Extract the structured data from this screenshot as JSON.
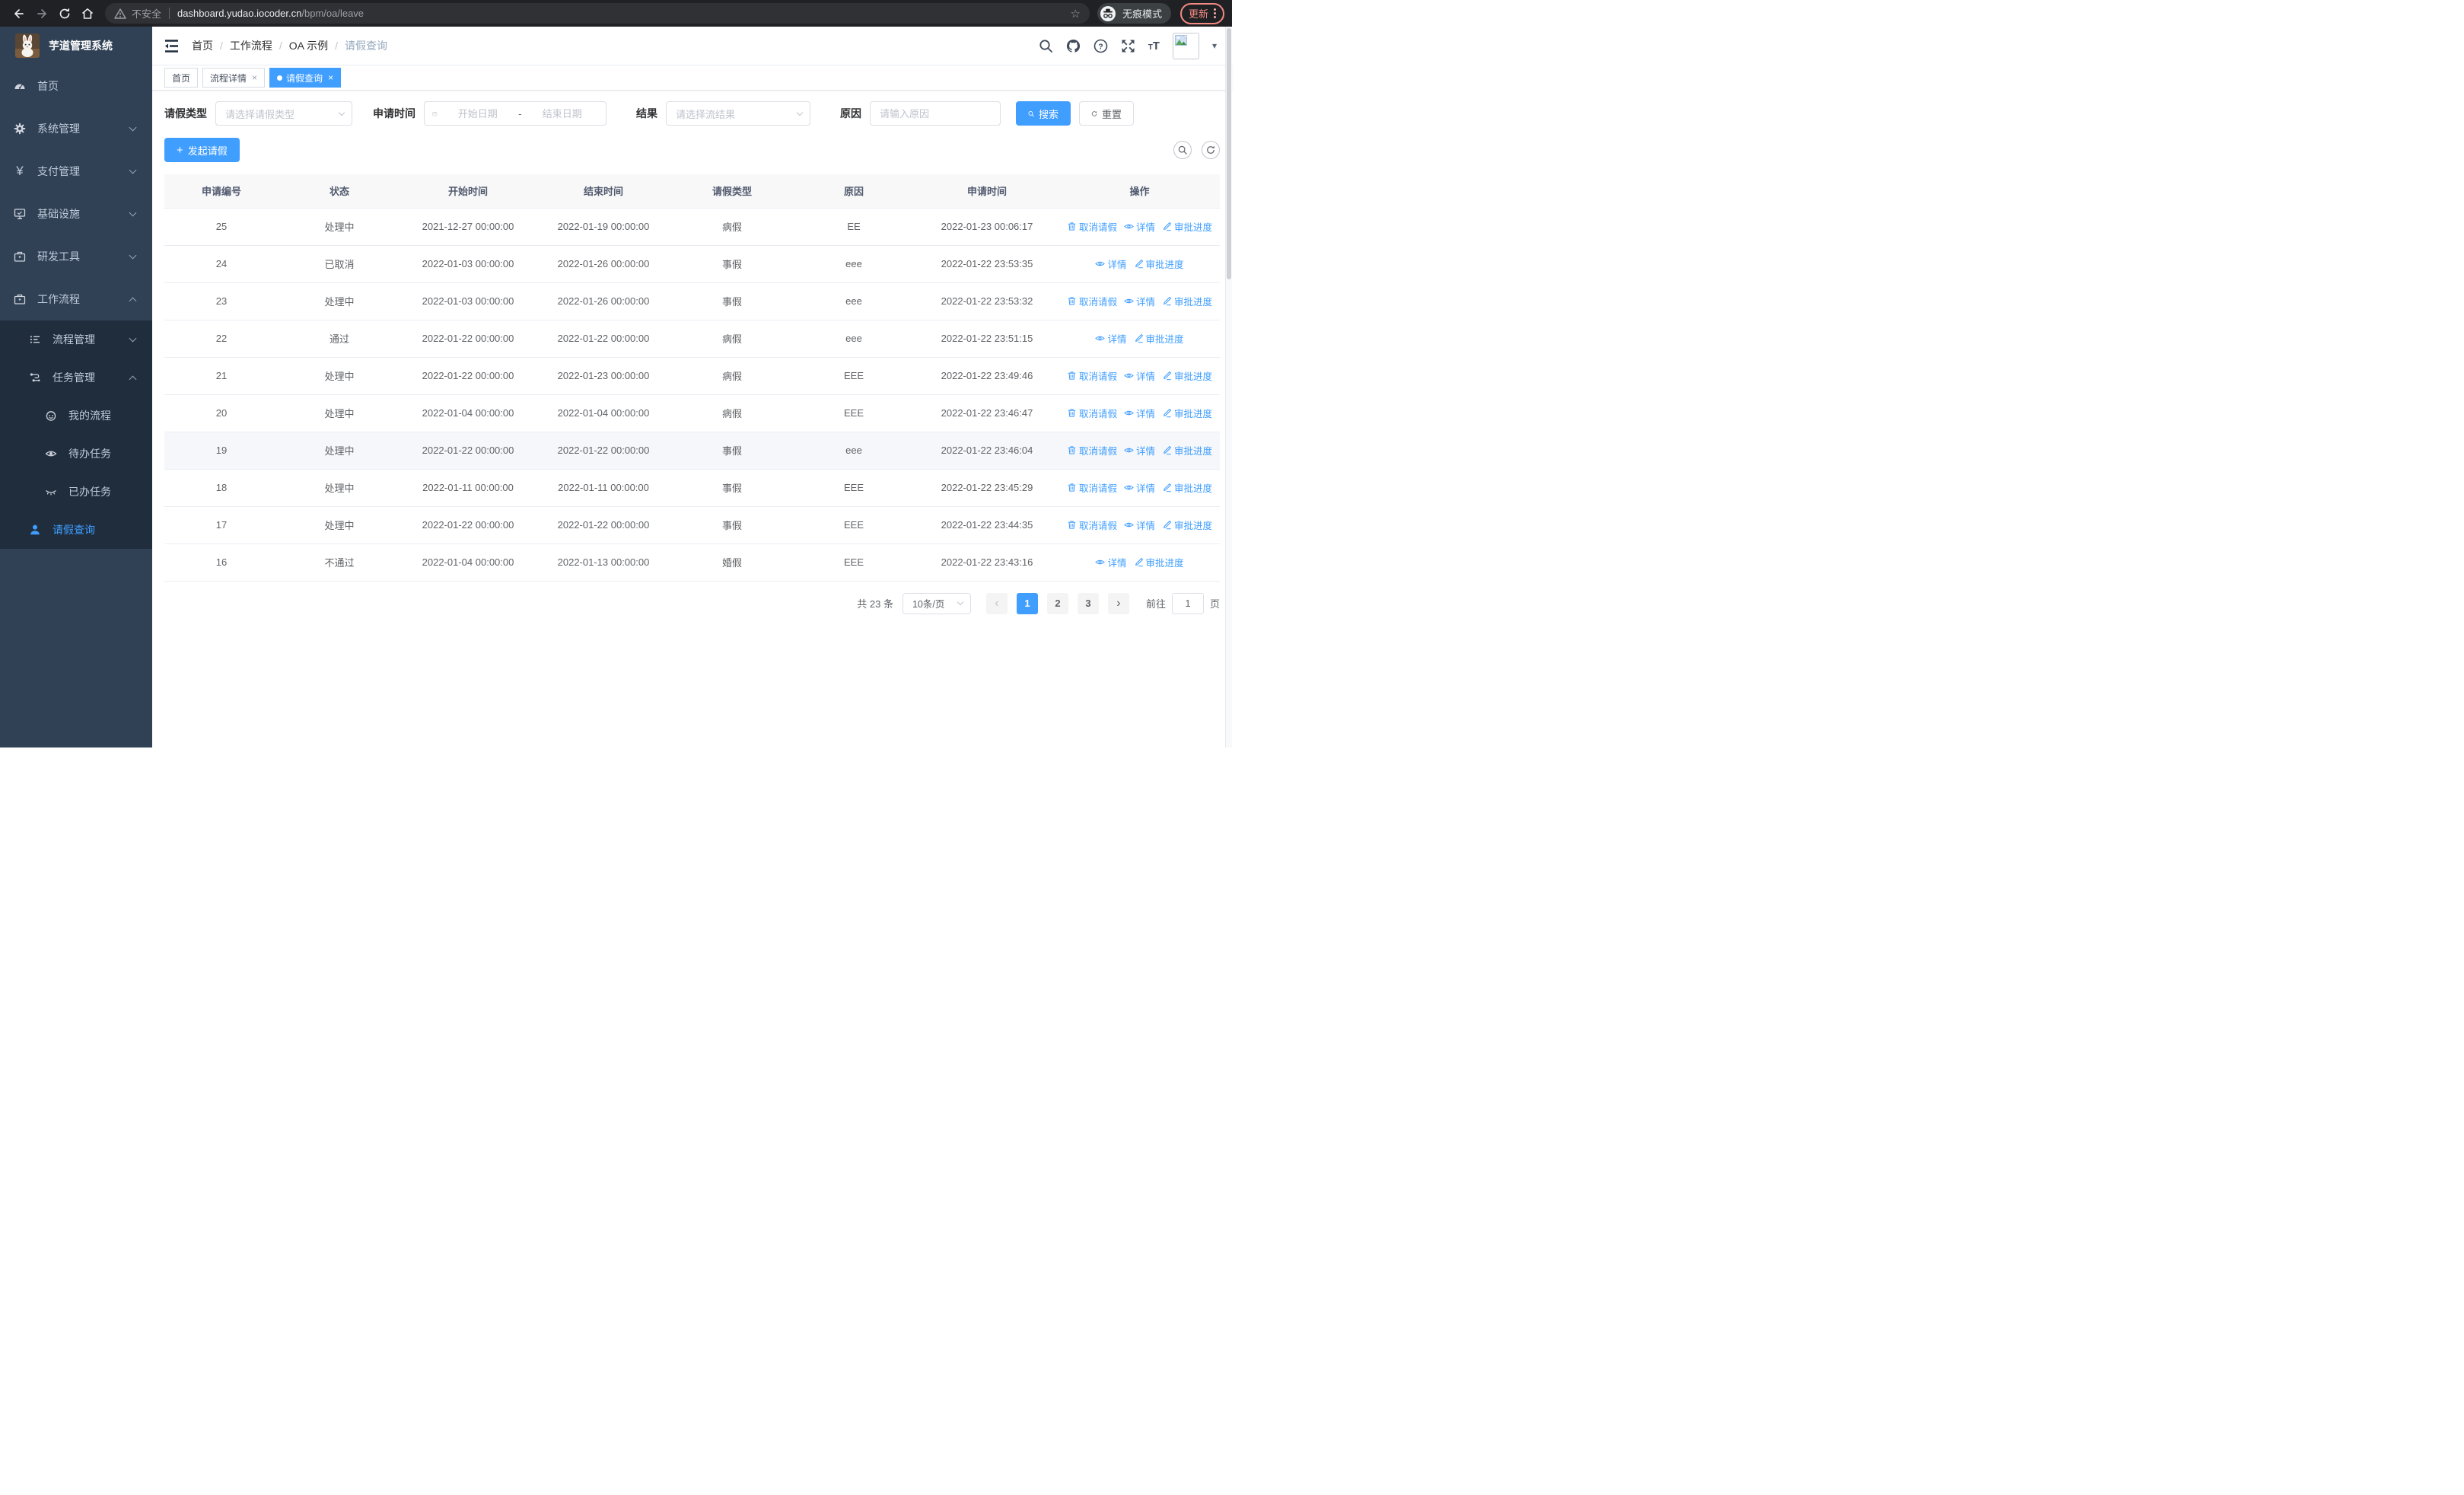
{
  "browser": {
    "security_warning": "不安全",
    "url_host": "dashboard.yudao.iocoder.cn",
    "url_path": "/bpm/oa/leave",
    "incognito_label": "无痕模式",
    "update_label": "更新"
  },
  "glyphs": {
    "star": "☆",
    "close": "×",
    "breadcrumb_separator": "/",
    "caret_down": "▾",
    "prev_arrow": "‹",
    "next_arrow": "›",
    "plus": "+"
  },
  "sidebar": {
    "app_title": "芋道管理系统",
    "items": [
      {
        "label": "首页"
      },
      {
        "label": "系统管理"
      },
      {
        "label": "支付管理"
      },
      {
        "label": "基础设施"
      },
      {
        "label": "研发工具"
      },
      {
        "label": "工作流程"
      }
    ],
    "submenu": [
      {
        "label": "流程管理"
      },
      {
        "label": "任务管理"
      },
      {
        "label": "我的流程"
      },
      {
        "label": "待办任务"
      },
      {
        "label": "已办任务"
      },
      {
        "label": "请假查询"
      }
    ]
  },
  "breadcrumb": [
    "首页",
    "工作流程",
    "OA 示例",
    "请假查询"
  ],
  "tabs": [
    {
      "label": "首页",
      "closable": false,
      "active": false
    },
    {
      "label": "流程详情",
      "closable": true,
      "active": false
    },
    {
      "label": "请假查询",
      "closable": true,
      "active": true
    }
  ],
  "filters": {
    "leave_type_label": "请假类型",
    "leave_type_placeholder": "请选择请假类型",
    "apply_time_label": "申请时间",
    "date_start_placeholder": "开始日期",
    "date_separator": "-",
    "date_end_placeholder": "结束日期",
    "result_label": "结果",
    "result_placeholder": "请选择流结果",
    "reason_label": "原因",
    "reason_placeholder": "请输入原因",
    "search_button": "搜索",
    "reset_button": "重置"
  },
  "toolbar": {
    "create_button": "发起请假"
  },
  "table": {
    "columns": [
      "申请编号",
      "状态",
      "开始时间",
      "结束时间",
      "请假类型",
      "原因",
      "申请时间",
      "操作"
    ],
    "rows": [
      {
        "id": "25",
        "status": "处理中",
        "start": "2021-12-27 00:00:00",
        "end": "2022-01-19 00:00:00",
        "type": "病假",
        "reason": "EE",
        "applied": "2022-01-23 00:06:17",
        "actions": [
          "取消请假",
          "详情",
          "审批进度"
        ],
        "highlight": false
      },
      {
        "id": "24",
        "status": "已取消",
        "start": "2022-01-03 00:00:00",
        "end": "2022-01-26 00:00:00",
        "type": "事假",
        "reason": "eee",
        "applied": "2022-01-22 23:53:35",
        "actions": [
          "详情",
          "审批进度"
        ],
        "highlight": false
      },
      {
        "id": "23",
        "status": "处理中",
        "start": "2022-01-03 00:00:00",
        "end": "2022-01-26 00:00:00",
        "type": "事假",
        "reason": "eee",
        "applied": "2022-01-22 23:53:32",
        "actions": [
          "取消请假",
          "详情",
          "审批进度"
        ],
        "highlight": false
      },
      {
        "id": "22",
        "status": "通过",
        "start": "2022-01-22 00:00:00",
        "end": "2022-01-22 00:00:00",
        "type": "病假",
        "reason": "eee",
        "applied": "2022-01-22 23:51:15",
        "actions": [
          "详情",
          "审批进度"
        ],
        "highlight": false
      },
      {
        "id": "21",
        "status": "处理中",
        "start": "2022-01-22 00:00:00",
        "end": "2022-01-23 00:00:00",
        "type": "病假",
        "reason": "EEE",
        "applied": "2022-01-22 23:49:46",
        "actions": [
          "取消请假",
          "详情",
          "审批进度"
        ],
        "highlight": false
      },
      {
        "id": "20",
        "status": "处理中",
        "start": "2022-01-04 00:00:00",
        "end": "2022-01-04 00:00:00",
        "type": "病假",
        "reason": "EEE",
        "applied": "2022-01-22 23:46:47",
        "actions": [
          "取消请假",
          "详情",
          "审批进度"
        ],
        "highlight": false
      },
      {
        "id": "19",
        "status": "处理中",
        "start": "2022-01-22 00:00:00",
        "end": "2022-01-22 00:00:00",
        "type": "事假",
        "reason": "eee",
        "applied": "2022-01-22 23:46:04",
        "actions": [
          "取消请假",
          "详情",
          "审批进度"
        ],
        "highlight": true
      },
      {
        "id": "18",
        "status": "处理中",
        "start": "2022-01-11 00:00:00",
        "end": "2022-01-11 00:00:00",
        "type": "事假",
        "reason": "EEE",
        "applied": "2022-01-22 23:45:29",
        "actions": [
          "取消请假",
          "详情",
          "审批进度"
        ],
        "highlight": false
      },
      {
        "id": "17",
        "status": "处理中",
        "start": "2022-01-22 00:00:00",
        "end": "2022-01-22 00:00:00",
        "type": "事假",
        "reason": "EEE",
        "applied": "2022-01-22 23:44:35",
        "actions": [
          "取消请假",
          "详情",
          "审批进度"
        ],
        "highlight": false
      },
      {
        "id": "16",
        "status": "不通过",
        "start": "2022-01-04 00:00:00",
        "end": "2022-01-13 00:00:00",
        "type": "婚假",
        "reason": "EEE",
        "applied": "2022-01-22 23:43:16",
        "actions": [
          "详情",
          "审批进度"
        ],
        "highlight": false
      }
    ]
  },
  "pagination": {
    "total_text": "共 23 条",
    "page_size": "10条/页",
    "pages": [
      "1",
      "2",
      "3"
    ],
    "active_page": "1",
    "goto_label": "前往",
    "goto_value": "1",
    "goto_suffix": "页"
  },
  "colors": {
    "primary": "#409eff",
    "sidebar_bg": "#304156",
    "submenu_bg": "#1f2d3d",
    "update_accent": "#f28b82"
  }
}
